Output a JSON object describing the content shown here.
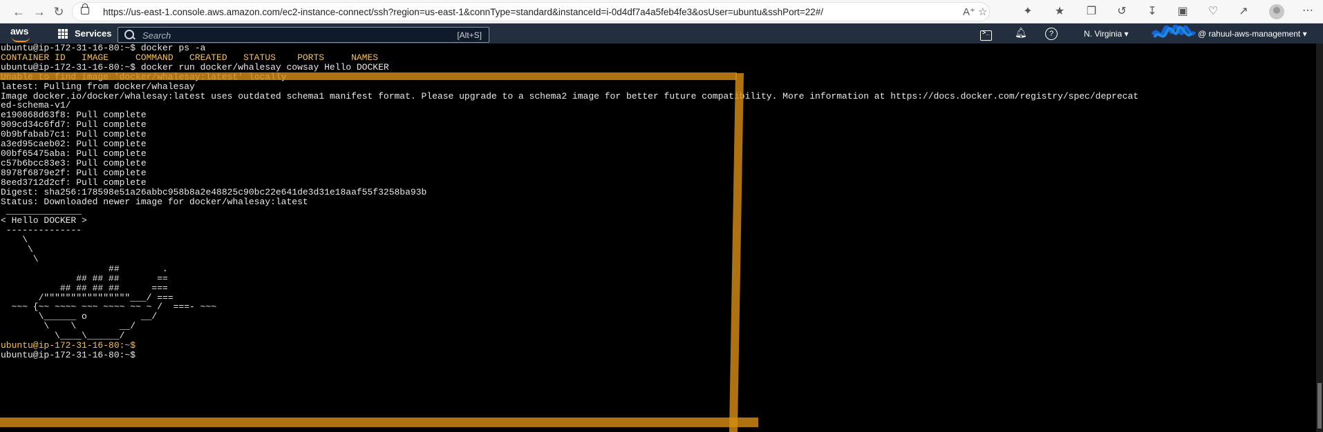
{
  "browser": {
    "url": "https://us-east-1.console.aws.amazon.com/ec2-instance-connect/ssh?region=us-east-1&connType=standard&instanceId=i-0d4df7a4a5feb4fe3&osUser=ubuntu&sshPort=22#/"
  },
  "aws_nav": {
    "logo": "aws",
    "services_label": "Services",
    "search_placeholder": "Search",
    "search_shortcut": "[Alt+S]",
    "region": "N. Virginia ▾",
    "account": "@ rahuul-aws-management ▾"
  },
  "terminal": {
    "lines": [
      "ubuntu@ip-172-31-16-80:~$ docker ps -a",
      "CONTAINER ID   IMAGE     COMMAND   CREATED   STATUS    PORTS     NAMES",
      "ubuntu@ip-172-31-16-80:~$ docker run docker/whalesay cowsay Hello DOCKER",
      "Unable to find image 'docker/whalesay:latest' locally",
      "latest: Pulling from docker/whalesay",
      "Image docker.io/docker/whalesay:latest uses outdated schema1 manifest format. Please upgrade to a schema2 image for better future compatibility. More information at https://docs.docker.com/registry/spec/deprecat",
      "ed-schema-v1/",
      "e190868d63f8: Pull complete",
      "909cd34c6fd7: Pull complete",
      "0b9bfabab7c1: Pull complete",
      "a3ed95caeb02: Pull complete",
      "00bf65475aba: Pull complete",
      "c57b6bcc83e3: Pull complete",
      "8978f6879e2f: Pull complete",
      "8eed3712d2cf: Pull complete",
      "Digest: sha256:178598e51a26abbc958b8a2e48825c90bc22e641de3d31e18aaf55f3258ba93b",
      "Status: Downloaded newer image for docker/whalesay:latest",
      " ______________",
      "< Hello DOCKER >",
      " --------------",
      "    \\",
      "     \\",
      "      \\",
      "                    ##        .",
      "              ## ## ##       ==",
      "           ## ## ## ##      ===",
      "       /\"\"\"\"\"\"\"\"\"\"\"\"\"\"\"\"___/ ===",
      "  ~~~ {~~ ~~~~ ~~~ ~~~~ ~~ ~ /  ===- ~~~",
      "       \\______ o          __/",
      "        \\    \\        __/",
      "          \\____\\______/",
      "ubuntu@ip-172-31-16-80:~$",
      "ubuntu@ip-172-31-16-80:~$"
    ]
  },
  "annotation_color": "#d48c14"
}
